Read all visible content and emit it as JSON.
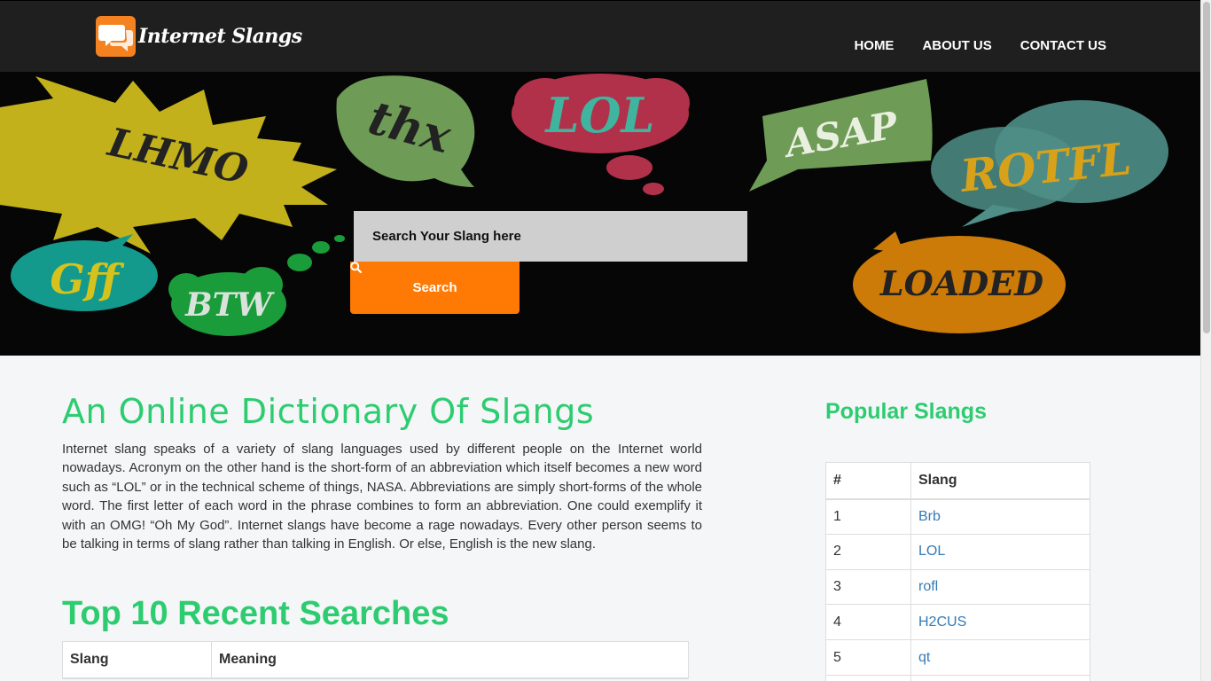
{
  "brand": {
    "name": "Internet Slangs"
  },
  "nav": [
    {
      "label": "HOME"
    },
    {
      "label": "ABOUT US"
    },
    {
      "label": "CONTACT US"
    }
  ],
  "hero": {
    "bubbles": [
      "LHMO",
      "thx",
      "LOL",
      "ASAP",
      "ROTFL",
      "Gff",
      "BTW",
      "LOADED"
    ],
    "search_placeholder": "Search Your Slang here",
    "search_button": "Search"
  },
  "main": {
    "title": "An Online Dictionary Of Slangs",
    "intro": "Internet slang speaks of a variety of slang languages used by different people on the Internet world nowadays. Acronym on the other hand is the short-form of an abbreviation which itself becomes a new word such as “LOL” or in the technical scheme of things, NASA. Abbreviations are simply short-forms of the whole word. The first letter of each word in the phrase combines to form an abbreviation. One could exemplify it with an OMG! “Oh My God”. Internet slangs have become a rage nowadays. Every other person seems to be talking in terms of slang rather than talking in English. Or else, English is the new slang.",
    "recent_title": "Top 10 Recent Searches",
    "recent_headers": [
      "Slang",
      "Meaning"
    ]
  },
  "popular": {
    "title": "Popular Slangs",
    "headers": [
      "#",
      "Slang"
    ],
    "rows": [
      {
        "num": "1",
        "slang": "Brb"
      },
      {
        "num": "2",
        "slang": "LOL"
      },
      {
        "num": "3",
        "slang": "rofl"
      },
      {
        "num": "4",
        "slang": "H2CUS"
      },
      {
        "num": "5",
        "slang": "qt"
      },
      {
        "num": "",
        "slang": ""
      }
    ]
  },
  "colors": {
    "accent_green": "#2ecc71",
    "accent_orange": "#ff7a05",
    "link_blue": "#337ab7",
    "navbar_bg": "#1f1f1f"
  }
}
